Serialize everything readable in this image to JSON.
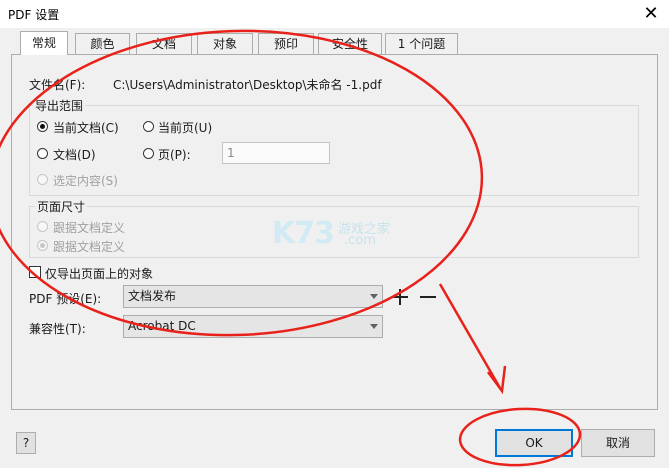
{
  "window": {
    "title": "PDF 设置",
    "close_glyph": "✕"
  },
  "tabs": [
    {
      "label": "常规",
      "active": true
    },
    {
      "label": "颜色"
    },
    {
      "label": "文档"
    },
    {
      "label": "对象"
    },
    {
      "label": "预印"
    },
    {
      "label": "安全性"
    },
    {
      "label": "1 个问题"
    }
  ],
  "general": {
    "filename_label": "文件名(F):",
    "filename_value": "C:\\Users\\Administrator\\Desktop\\未命名 -1.pdf",
    "export_range": {
      "title": "导出范围",
      "current_doc": "当前文档(C)",
      "current_page": "当前页(U)",
      "documents": "文档(D)",
      "pages": "页(P):",
      "pages_value": "1",
      "selection": "选定内容(S)",
      "selected": "current_doc"
    },
    "page_size": {
      "title": "页面尺寸",
      "option_1": "跟据文档定义",
      "option_2": "跟据文档定义"
    },
    "export_objects_only": {
      "label": "仅导出页面上的对象",
      "checked": false
    },
    "pdf_preset": {
      "label": "PDF 预设(E):",
      "value": "文档发布"
    },
    "compatibility": {
      "label": "兼容性(T):",
      "value": "Acrobat DC"
    }
  },
  "watermark": {
    "brand": "K73",
    "text_cn": "游戏之家",
    "text_com": ".com"
  },
  "footer": {
    "help": "?",
    "ok": "OK",
    "cancel": "取消"
  },
  "colors": {
    "annotation_red": "#e8221a",
    "accent": "#0078d7",
    "watermark": "#bfe3f0"
  }
}
